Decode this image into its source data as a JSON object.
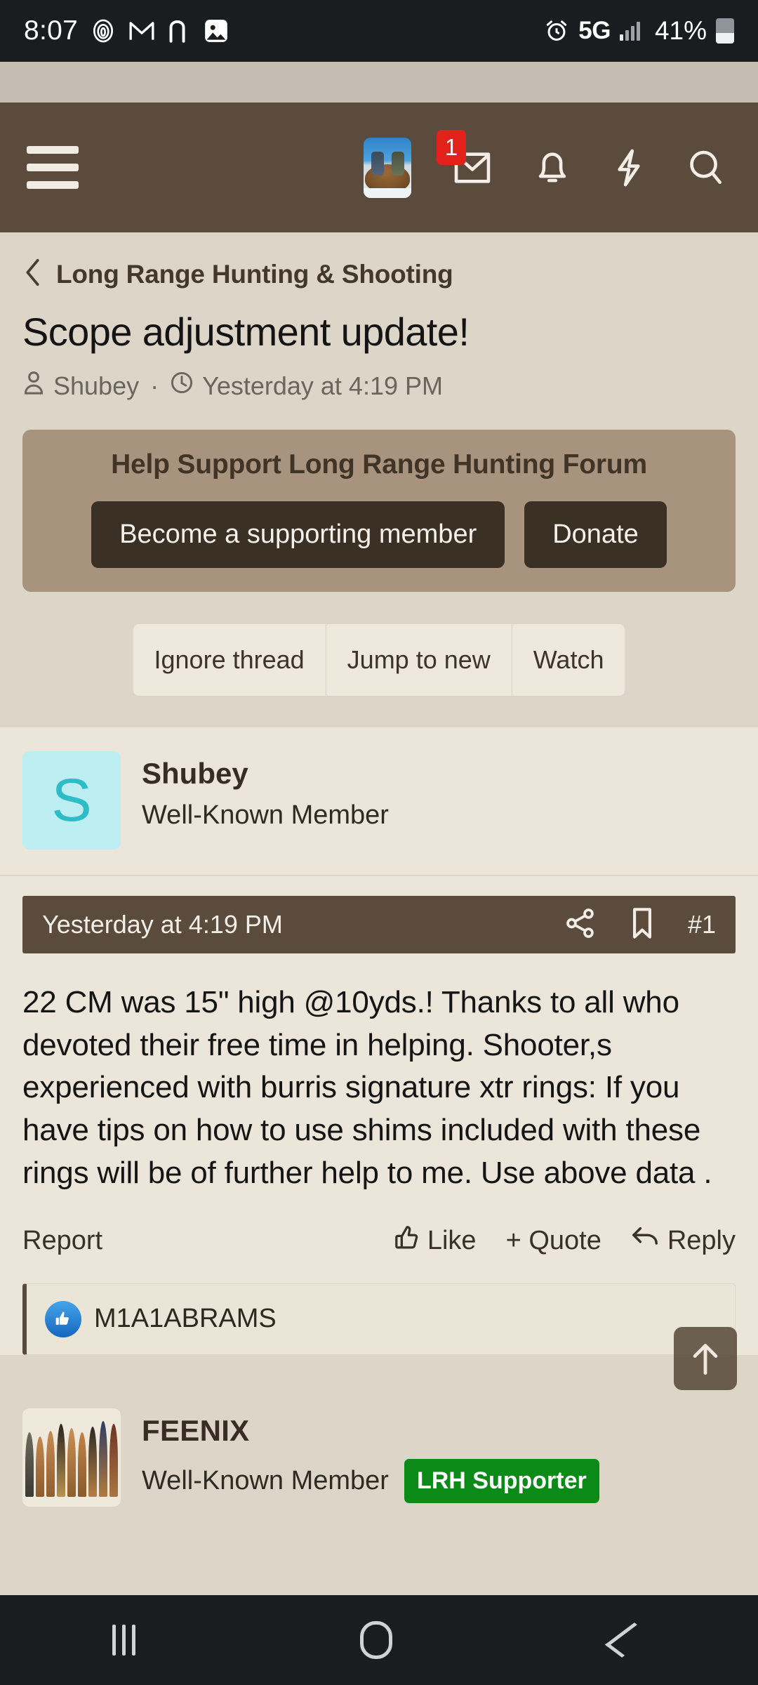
{
  "status_bar": {
    "time": "8:07",
    "left_icons": [
      "fingerprint-icon",
      "gmail-icon",
      "reddit-icon",
      "photos-icon"
    ],
    "alarm_icon": "alarm-icon",
    "network": "5G",
    "battery_percent": "41%"
  },
  "header": {
    "menu_icon": "hamburger-menu-icon",
    "avatar_alt": "user-avatar-hunting-photo",
    "inbox_badge": "1",
    "icons": [
      "inbox-icon",
      "bell-icon",
      "bolt-icon",
      "search-icon"
    ]
  },
  "thread": {
    "breadcrumb": "Long Range Hunting & Shooting",
    "title": "Scope adjustment update!",
    "author": "Shubey",
    "separator": "·",
    "timestamp": "Yesterday at 4:19 PM"
  },
  "support_banner": {
    "heading": "Help Support Long Range Hunting Forum",
    "primary_button": "Become a supporting member",
    "secondary_button": "Donate",
    "bg_color": "#a8937e",
    "button_color": "#3b3024"
  },
  "thread_actions": [
    "Ignore thread",
    "Jump to new",
    "Watch"
  ],
  "post": {
    "author": "Shubey",
    "avatar_letter": "S",
    "avatar_bg": "#bdeef1",
    "avatar_fg": "#2ebcc6",
    "role": "Well-Known Member",
    "timestamp": "Yesterday at 4:19 PM",
    "post_number": "#1",
    "bar_icons": [
      "share-icon",
      "bookmark-icon"
    ],
    "body": "22 CM was 15\" high @10yds.! Thanks to all who devoted their free time in helping. Shooter,s experienced with burris signature xtr rings: If you have tips on how to use shims included with these rings will be of further help to me. Use above data .",
    "footer": {
      "report": "Report",
      "like": "Like",
      "quote": "+ Quote",
      "reply": "Reply"
    },
    "reactions": {
      "icon": "thumbs-up-badge-icon",
      "names": "M1A1ABRAMS"
    }
  },
  "next_post": {
    "author": "FEENIX",
    "role": "Well-Known Member",
    "badge": "LRH Supporter",
    "badge_color": "#0c8a17",
    "avatar_alt": "bullets-photo-avatar"
  },
  "scroll_top_button": "scroll-to-top-icon",
  "nav_bar": {
    "recents": "recents-icon",
    "home": "home-icon",
    "back": "back-icon"
  }
}
